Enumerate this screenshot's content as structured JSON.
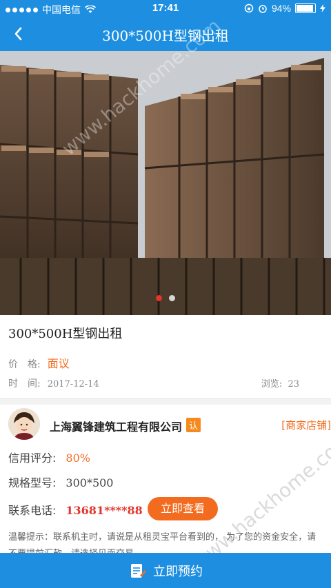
{
  "status_bar": {
    "carrier": "中国电信",
    "time": "17:41",
    "battery": "94%",
    "battery_level": 0.94
  },
  "nav": {
    "title": "300*500H型钢出租"
  },
  "gallery": {
    "page_count": 2,
    "active_index": 0,
    "active_color": "#e2342a",
    "inactive_color": "#d6d6d6"
  },
  "product": {
    "title": "300*500H型钢出租",
    "price_label": "价　格:",
    "price_value": "面议",
    "time_label": "时　间:",
    "time_value": "2017-12-14",
    "views_label": "浏览:",
    "views_value": "23"
  },
  "seller": {
    "company": "上海翼锋建筑工程有限公司",
    "certified_badge": "认",
    "shop_link": "[商家店铺]",
    "credit_label": "信用评分:",
    "credit_value": "80%",
    "spec_label": "规格型号:",
    "spec_value": "300*500",
    "phone_label": "联系电话:",
    "phone_value": "13681****88",
    "view_button": "立即查看"
  },
  "tip": {
    "text": "温馨提示：联系机主时，请说是从租灵宝平台看到的， 为了您的资金安全，请不要提前汇款，请选择见面交易。"
  },
  "bottom": {
    "reserve_button": "立即预约"
  },
  "watermark": {
    "text": "www.hackhome.com"
  },
  "colors": {
    "primary": "#1e8fe0",
    "accent": "#f36b1f"
  }
}
